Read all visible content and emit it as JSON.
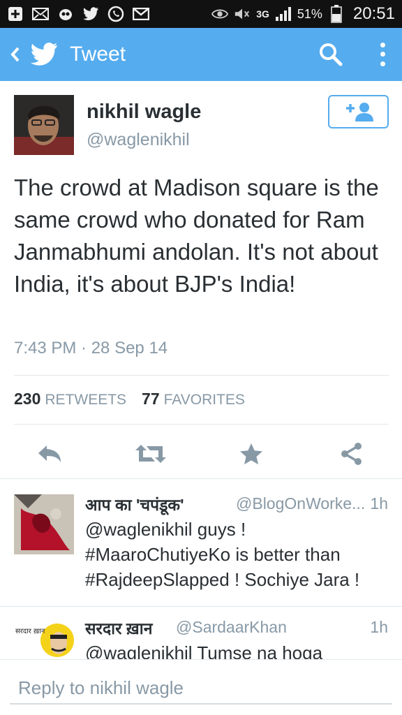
{
  "status_bar": {
    "network": "3G",
    "battery": "51%",
    "time": "20:51",
    "left_icons": [
      "add-icon",
      "mail-icon",
      "hike-icon",
      "twitter-icon",
      "whatsapp-icon",
      "gmail-icon"
    ]
  },
  "app_bar": {
    "title": "Tweet",
    "color": "#55acee"
  },
  "tweet": {
    "name": "nikhil wagle",
    "handle": "@waglenikhil",
    "text": "The crowd at Madison square is the same crowd who donated for Ram Janmabhumi andolan. It's not about India, it's about BJP's India!",
    "timestamp": "7:43 PM · 28 Sep 14",
    "retweets": "230",
    "retweets_label": "RETWEETS",
    "favorites": "77",
    "favorites_label": "FAVORITES"
  },
  "replies": [
    {
      "name": "आप का 'चपंडूक'",
      "handle": "@BlogOnWorke...",
      "time": "1h",
      "text": "@waglenikhil guys ! #MaaroChutiyeKo is better than #RajdeepSlapped ! Sochiye Jara !"
    },
    {
      "name": "सरदार ख़ान",
      "handle": "@SardaarKhan",
      "time": "1h",
      "text": "@waglenikhil Tumse na hoga",
      "avatar_text": "सरदार ख़ान"
    }
  ],
  "reply_bar": {
    "placeholder": "Reply to nikhil wagle"
  },
  "colors": {
    "accent": "#55acee",
    "text": "#292f33",
    "muted": "#8899a6",
    "star": "#8899a6"
  }
}
